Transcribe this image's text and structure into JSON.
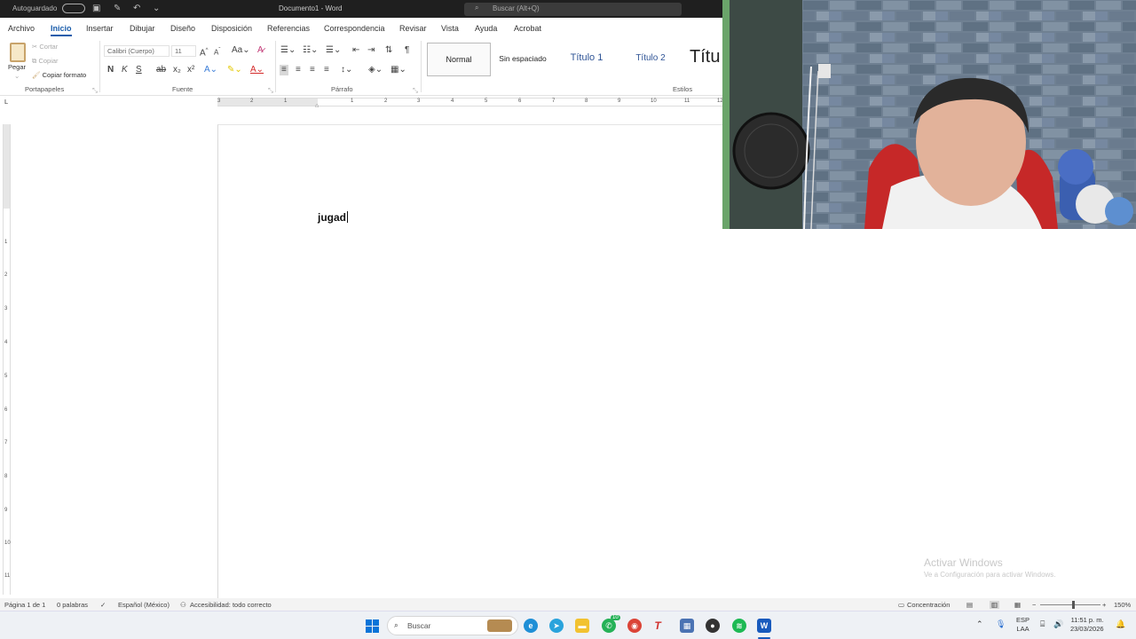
{
  "titlebar": {
    "autosave": "Autoguardado",
    "doc_title": "Documento1 - Word",
    "search_placeholder": "Buscar (Alt+Q)"
  },
  "tabs": [
    "Archivo",
    "Inicio",
    "Insertar",
    "Dibujar",
    "Diseño",
    "Disposición",
    "Referencias",
    "Correspondencia",
    "Revisar",
    "Vista",
    "Ayuda",
    "Acrobat"
  ],
  "active_tab": "Inicio",
  "ribbon": {
    "clipboard": {
      "paste": "Pegar",
      "cut": "Cortar",
      "copy": "Copiar",
      "format_painter": "Copiar formato",
      "label": "Portapapeles"
    },
    "font": {
      "font_name": "Calibri (Cuerpo)",
      "font_size": "11",
      "bold": "N",
      "italic": "K",
      "underline": "S",
      "label": "Fuente"
    },
    "paragraph": {
      "label": "Párrafo"
    },
    "styles": {
      "items": [
        "Normal",
        "Sin espaciado",
        "Título 1",
        "Título 2",
        "Títu"
      ],
      "label": "Estilos"
    }
  },
  "ruler": {
    "h_numbers": [
      "3",
      "2",
      "1",
      "1",
      "2",
      "3",
      "4",
      "5",
      "6",
      "7",
      "8",
      "9",
      "10",
      "11",
      "12"
    ],
    "v_numbers": [
      "1",
      "2",
      "3",
      "4",
      "5",
      "6",
      "7",
      "8",
      "9",
      "10",
      "11"
    ]
  },
  "document": {
    "text": "jugad"
  },
  "watermark": {
    "line1": "Activar Windows",
    "line2": "Ve a Configuración para activar Windows."
  },
  "statusbar": {
    "page": "Página 1 de 1",
    "words": "0 palabras",
    "language": "Español (México)",
    "accessibility": "Accesibilidad: todo correcto",
    "focus": "Concentración",
    "zoom": "150%",
    "zoom_level": 0.5
  },
  "taskbar": {
    "search": "Buscar",
    "lang": "ESP",
    "region": "LAA",
    "time": "11:51 p. m.",
    "date": "23/03/2026",
    "whatsapp_badge": "10"
  },
  "colors": {
    "accent": "#1a5dab",
    "title_bg": "#1f1f1f",
    "word_blue": "#185abd"
  }
}
